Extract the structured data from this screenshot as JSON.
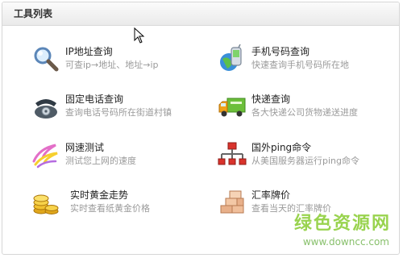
{
  "panel": {
    "title": "工具列表"
  },
  "tools": [
    {
      "title": "IP地址查询",
      "desc": "可查ip→地址、地址→ip",
      "icon": "magnifier-icon"
    },
    {
      "title": "手机号码查询",
      "desc": "快速查询手机号码所在地",
      "icon": "mobile-globe-icon"
    },
    {
      "title": "固定电话查询",
      "desc": "查询电话号码所在街道村镇",
      "icon": "telephone-icon"
    },
    {
      "title": "快递查询",
      "desc": "各大快递公司货物递送进度",
      "icon": "delivery-truck-icon"
    },
    {
      "title": "网速测试",
      "desc": "测试您上网的速度",
      "icon": "speed-swirl-icon"
    },
    {
      "title": "国外ping命令",
      "desc": "从美国服务器运行ping命令",
      "icon": "network-tree-icon"
    },
    {
      "title": "实时黄金走势",
      "desc": "实时查看纸黄金价格",
      "icon": "gold-coins-icon"
    },
    {
      "title": "汇率牌价",
      "desc": "查看当天的汇率牌价",
      "icon": "brick-stack-icon"
    }
  ],
  "watermark": {
    "brand": "绿色资源网",
    "url": "www.downcc.com"
  }
}
